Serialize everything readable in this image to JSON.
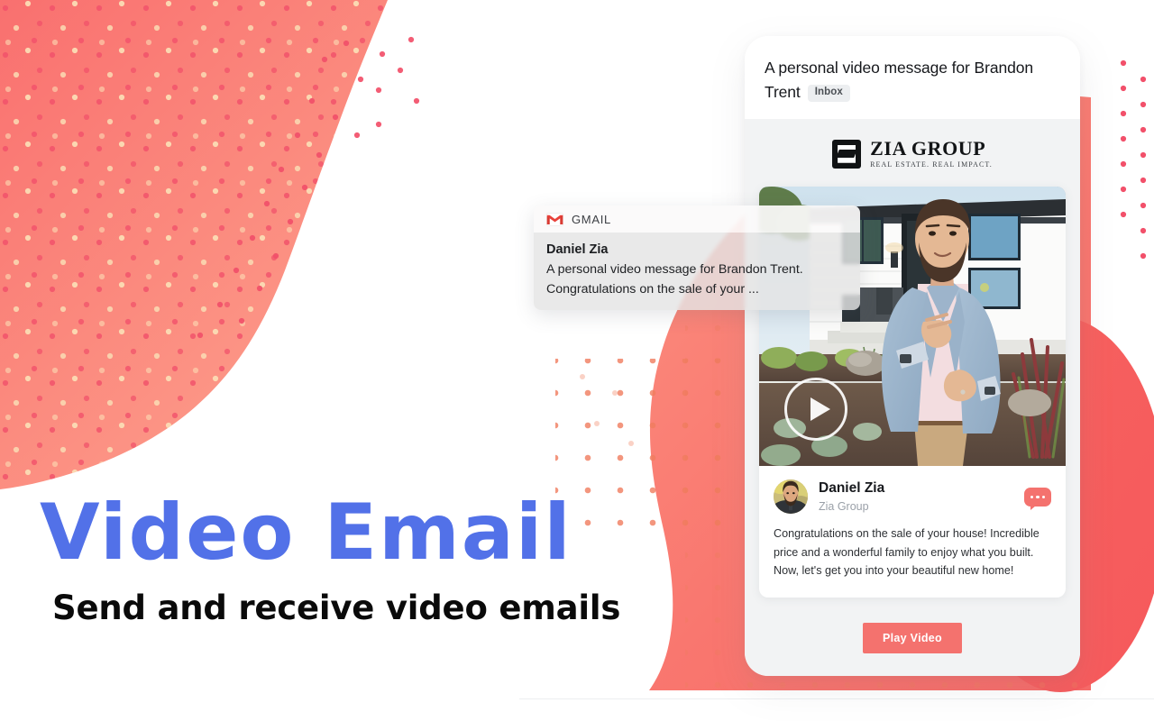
{
  "hero": {
    "title": "Video Email",
    "title_color": "#5271e8",
    "subtitle": "Send and receive video emails",
    "subtitle_color": "#0a0a0a"
  },
  "theme": {
    "coral": "#f4726e",
    "coral_light": "#fb9183",
    "blue": "#5271e8",
    "phone_bg": "#f2f3f4",
    "dot_pink": "#f2506a",
    "dot_cream": "#fbdcb4"
  },
  "notification": {
    "app_name": "GMAIL",
    "app_icon": "gmail-icon",
    "sender": "Daniel Zia",
    "preview_line_1": "A personal video message for Brandon Trent.",
    "preview_line_2": "Congratulations on the sale of your ..."
  },
  "phone": {
    "subject": "A personal video message for Brandon Trent",
    "label_badge": "Inbox",
    "brand": {
      "name": "ZIA GROUP",
      "tagline": "REAL ESTATE. REAL IMPACT.",
      "mark": "zia-z-logo"
    },
    "video": {
      "play_icon": "play-triangle-icon",
      "alt": "Man in light blue blazer standing in front of a modern white house"
    },
    "sender": {
      "avatar": "avatar-daniel-zia",
      "name": "Daniel Zia",
      "organization": "Zia Group",
      "menu_icon": "chat-bubble-ellipsis-icon"
    },
    "message_body": "Congratulations on the sale of your house! Incredible price and a wonderful family to enjoy what you built. Now, let's get you into your beautiful new home!",
    "cta_label": "Play Video"
  }
}
